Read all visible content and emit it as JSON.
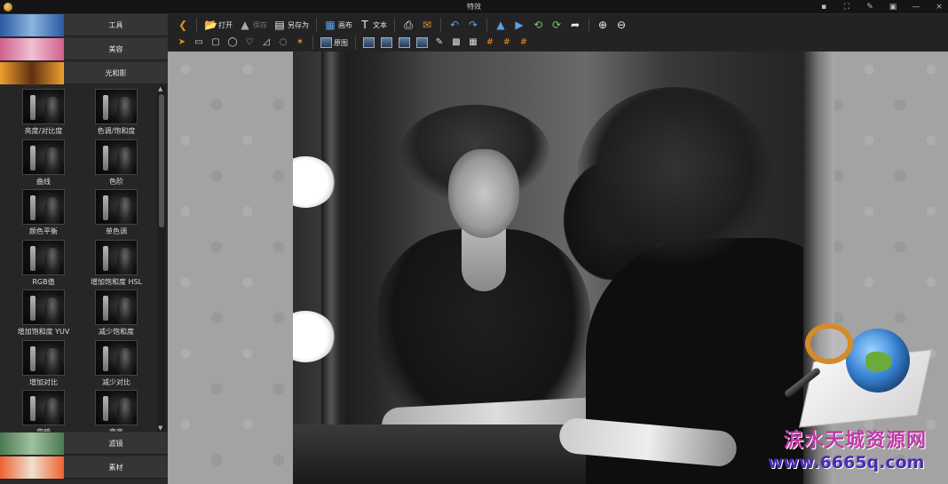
{
  "window": {
    "title": "特效",
    "controls": [
      "▪",
      "⛶",
      "✎",
      "▣",
      "—",
      "×"
    ]
  },
  "sidebar": {
    "categories_top": [
      {
        "label": "工具",
        "thumb_colors": [
          "#2a5aa0",
          "#8ab4e0"
        ]
      },
      {
        "label": "美容",
        "thumb_colors": [
          "#d06090",
          "#f0c0d0"
        ]
      },
      {
        "label": "光和影",
        "thumb_colors": [
          "#f0a030",
          "#603010"
        ]
      }
    ],
    "effects": [
      "亮度/对比度",
      "色调/饱和度",
      "曲线",
      "色阶",
      "颜色平衡",
      "单色调",
      "RGB值",
      "增加饱和度 HSL",
      "增加饱和度 YUV",
      "减少饱和度",
      "增加对比",
      "减少对比",
      "变暗",
      "变亮"
    ],
    "categories_bottom": [
      {
        "label": "滤镜",
        "thumb_colors": [
          "#4a7a50",
          "#a0c0a0"
        ]
      },
      {
        "label": "素材",
        "thumb_colors": [
          "#f06030",
          "#f0e0d0"
        ]
      }
    ]
  },
  "toolbar": {
    "row1": [
      {
        "icon": "back-arrow-icon",
        "glyph": "❮",
        "label": "",
        "color": "orange",
        "disabled": false
      },
      {
        "sep": true
      },
      {
        "icon": "open-folder-icon",
        "glyph": "📂",
        "label": "打开",
        "color": "orange",
        "disabled": false
      },
      {
        "icon": "save-icon",
        "glyph": "▲",
        "label": "保存",
        "color": "gray",
        "disabled": true
      },
      {
        "icon": "save-as-icon",
        "glyph": "▤",
        "label": "另存为",
        "color": "white",
        "disabled": false
      },
      {
        "sep": true
      },
      {
        "icon": "canvas-icon",
        "glyph": "▦",
        "label": "画布",
        "color": "blue",
        "disabled": false
      },
      {
        "icon": "text-icon",
        "glyph": "T",
        "label": "文本",
        "color": "white",
        "disabled": false
      },
      {
        "sep": true
      },
      {
        "icon": "print-icon",
        "glyph": "⎙",
        "label": "",
        "color": "white",
        "disabled": false
      },
      {
        "icon": "email-icon",
        "glyph": "✉",
        "label": "",
        "color": "orange",
        "disabled": false
      },
      {
        "sep": true
      },
      {
        "icon": "undo-icon",
        "glyph": "↶",
        "label": "",
        "color": "blue",
        "disabled": false
      },
      {
        "icon": "redo-icon",
        "glyph": "↷",
        "label": "",
        "color": "blue",
        "disabled": false
      },
      {
        "sep": true
      },
      {
        "icon": "flip-vertical-icon",
        "glyph": "▲",
        "label": "",
        "color": "blue",
        "disabled": false
      },
      {
        "icon": "flip-horizontal-icon",
        "glyph": "▶",
        "label": "",
        "color": "blue",
        "disabled": false
      },
      {
        "icon": "rotate-left-icon",
        "glyph": "⟲",
        "label": "",
        "color": "green",
        "disabled": false
      },
      {
        "icon": "rotate-right-icon",
        "glyph": "⟳",
        "label": "",
        "color": "green",
        "disabled": false
      },
      {
        "icon": "share-icon",
        "glyph": "➦",
        "label": "",
        "color": "white",
        "disabled": false
      },
      {
        "sep": true
      },
      {
        "icon": "zoom-in-icon",
        "glyph": "⊕",
        "label": "",
        "color": "white",
        "disabled": false
      },
      {
        "icon": "zoom-out-icon",
        "glyph": "⊖",
        "label": "",
        "color": "white",
        "disabled": false
      }
    ],
    "row2": [
      {
        "icon": "pointer-icon",
        "glyph": "➤",
        "label": "",
        "color": "orange"
      },
      {
        "icon": "rect-select-icon",
        "glyph": "▭",
        "label": "",
        "color": "white"
      },
      {
        "icon": "rounded-rect-select-icon",
        "glyph": "▢",
        "label": "",
        "color": "white"
      },
      {
        "icon": "ellipse-select-icon",
        "glyph": "◯",
        "label": "",
        "color": "white"
      },
      {
        "icon": "heart-select-icon",
        "glyph": "♡",
        "label": "",
        "color": "white"
      },
      {
        "icon": "lasso-select-icon",
        "glyph": "◿",
        "label": "",
        "color": "white"
      },
      {
        "icon": "speech-bubble-select-icon",
        "glyph": "◌",
        "label": "",
        "color": "white"
      },
      {
        "icon": "magic-wand-icon",
        "glyph": "✶",
        "label": "",
        "color": "orange"
      },
      {
        "sep": true
      },
      {
        "icon": "original-image-icon",
        "glyph": "photo",
        "label": "原图",
        "color": "white"
      },
      {
        "sep": true
      },
      {
        "icon": "layer-icon-1",
        "glyph": "photo",
        "label": "",
        "color": "white"
      },
      {
        "icon": "layer-icon-2",
        "glyph": "photo",
        "label": "",
        "color": "white"
      },
      {
        "icon": "layer-icon-3",
        "glyph": "photo",
        "label": "",
        "color": "white"
      },
      {
        "icon": "layer-icon-4",
        "glyph": "photo",
        "label": "",
        "color": "white"
      },
      {
        "icon": "clone-stamp-icon",
        "glyph": "✎",
        "label": "",
        "color": "white"
      },
      {
        "icon": "checkerboard-icon",
        "glyph": "▩",
        "label": "",
        "color": "white"
      },
      {
        "icon": "grid-icon",
        "glyph": "▦",
        "label": "",
        "color": "white"
      },
      {
        "icon": "hash-grid-icon-1",
        "glyph": "#",
        "label": "",
        "color": "orange"
      },
      {
        "icon": "hash-grid-icon-2",
        "glyph": "#",
        "label": "",
        "color": "orange"
      },
      {
        "icon": "hash-grid-icon-3",
        "glyph": "#",
        "label": "",
        "color": "orange"
      }
    ]
  },
  "watermark": {
    "text_cn": "涙水天城资源网",
    "url": "www.6665q.com"
  }
}
